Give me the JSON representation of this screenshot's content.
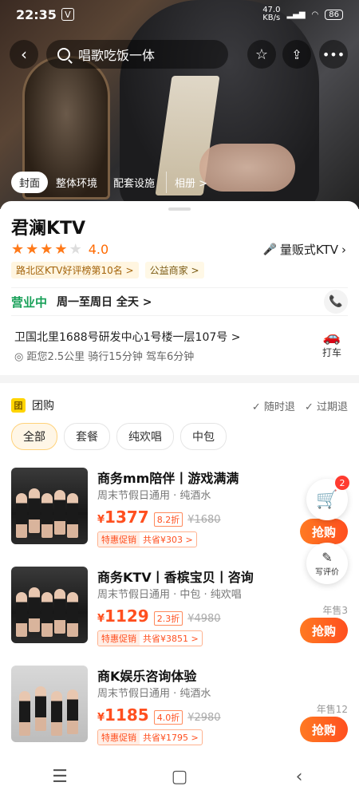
{
  "status_bar": {
    "time": "22:35",
    "app_badge": "V",
    "net_speed": "47.0\nKB/s",
    "battery": "86"
  },
  "top_bar": {
    "search_text": "唱歌吃饭一体",
    "icons": [
      "back-icon",
      "search-icon",
      "star-icon",
      "share-icon",
      "more-icon"
    ]
  },
  "hero_tabs": [
    "封面",
    "整体环境",
    "配套设施",
    "相册 >"
  ],
  "shop": {
    "name": "君澜KTV",
    "rating": 4.0,
    "rating_text": "4.0",
    "stars": [
      true,
      true,
      true,
      true,
      false
    ],
    "category": "量贩式KTV",
    "badges": [
      "路北区KTV好评榜第10名 >",
      "公益商家 >"
    ],
    "open_status": "营业中",
    "hours": "周一至周日 全天 >",
    "address": "卫国北里1688号研发中心1号楼一层107号 >",
    "distance": "距您2.5公里 骑行15分钟 驾车6分钟",
    "taxi_label": "打车"
  },
  "group_buy": {
    "title": "团购",
    "tag": "团",
    "policies": [
      "随时退",
      "过期退"
    ],
    "filters": [
      "全部",
      "套餐",
      "纯欢唱",
      "中包"
    ],
    "active_filter": 0,
    "deals": [
      {
        "title": "商务mm陪伴丨游戏满满",
        "sub": "周末节假日通用 · 纯酒水",
        "price": "1377",
        "discount": "8.2折",
        "original": "¥1680",
        "promo_a": "特惠促销",
        "promo_b": "共省¥303 >",
        "sold": "",
        "buy": "抢购"
      },
      {
        "title": "商务KTV丨香槟宝贝丨咨询",
        "sub": "周末节假日通用 · 中包 · 纯欢唱",
        "price": "1129",
        "discount": "2.3折",
        "original": "¥4980",
        "promo_a": "特惠促销",
        "promo_b": "共省¥3851 >",
        "sold": "年售3",
        "buy": "抢购"
      },
      {
        "title": "商K娱乐咨询体验",
        "sub": "周末节假日通用 · 纯酒水",
        "price": "1185",
        "discount": "4.0折",
        "original": "¥2980",
        "promo_a": "特惠促销",
        "promo_b": "共省¥1795 >",
        "sold": "年售12",
        "buy": "抢购"
      }
    ]
  },
  "floating": {
    "cart_count": "2",
    "review_label": "写评价"
  },
  "colors": {
    "accent": "#ff4f1f",
    "open_green": "#18a058",
    "star": "#ff7a1a"
  }
}
